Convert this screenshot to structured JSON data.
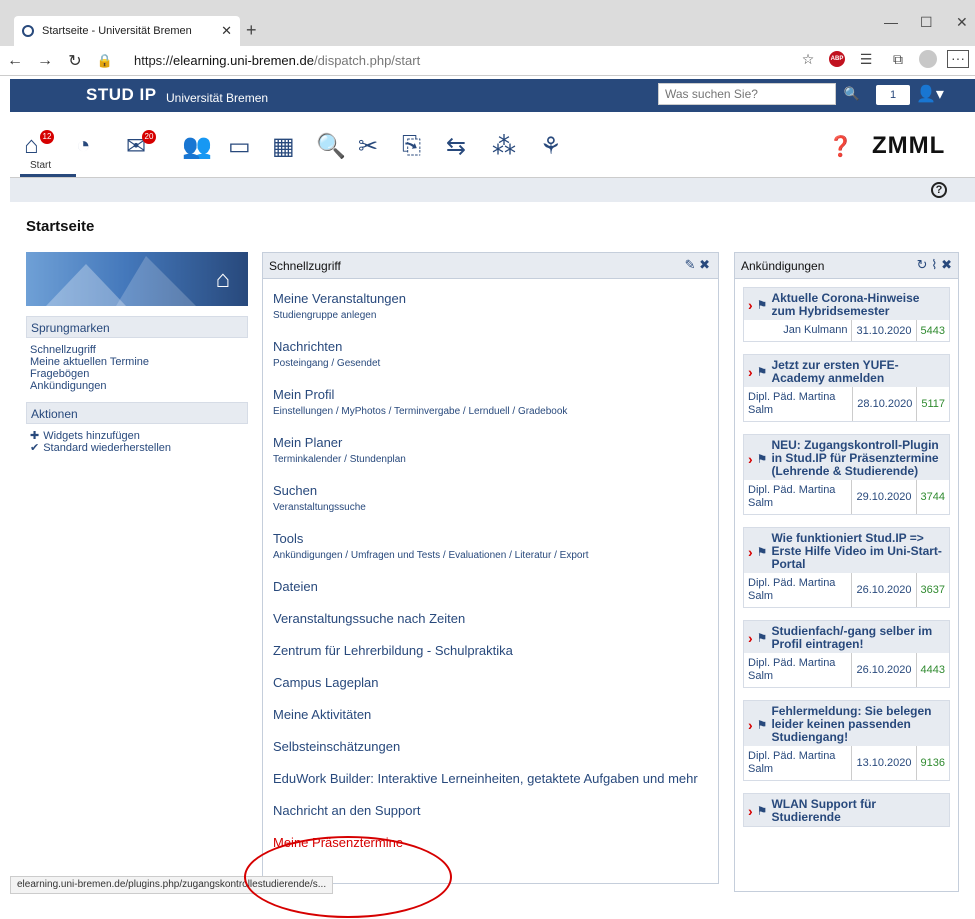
{
  "browser": {
    "tab_title": "Startseite - Universität Bremen",
    "url_scheme": "https://",
    "url_host": "elearning.uni-bremen.de",
    "url_path": "/dispatch.php/start",
    "status_url": "elearning.uni-bremen.de/plugins.php/zugangskontrollestudierende/s..."
  },
  "header": {
    "logo": "STUD IP",
    "university": "Universität Bremen",
    "search_placeholder": "Was suchen Sie?",
    "notification_count": "1"
  },
  "nav": {
    "start_label": "Start",
    "home_badge": "12",
    "messages_badge": "20",
    "brand_right": "ZMML"
  },
  "page": {
    "title": "Startseite"
  },
  "sidebar": {
    "jump_title": "Sprungmarken",
    "jump_links": [
      "Schnellzugriff",
      "Meine aktuellen Termine",
      "Fragebögen",
      "Ankündigungen"
    ],
    "actions_title": "Aktionen",
    "actions": [
      {
        "label": "Widgets hinzufügen",
        "icon": "plus-icon"
      },
      {
        "label": "Standard wiederherstellen",
        "icon": "check-icon"
      }
    ]
  },
  "quickaccess": {
    "title": "Schnellzugriff",
    "items": [
      {
        "title": "Meine Veranstaltungen",
        "sub": "Studiengruppe anlegen"
      },
      {
        "title": "Nachrichten",
        "sub": "Posteingang / Gesendet"
      },
      {
        "title": "Mein Profil",
        "sub": "Einstellungen / MyPhotos / Terminvergabe / Lernduell / Gradebook"
      },
      {
        "title": "Mein Planer",
        "sub": "Terminkalender / Stundenplan"
      },
      {
        "title": "Suchen",
        "sub": "Veranstaltungssuche"
      },
      {
        "title": "Tools",
        "sub": "Ankündigungen / Umfragen und Tests / Evaluationen / Literatur / Export"
      },
      {
        "title": "Dateien",
        "sub": ""
      },
      {
        "title": "Veranstaltungssuche nach Zeiten",
        "sub": ""
      },
      {
        "title": "Zentrum für Lehrerbildung - Schulpraktika",
        "sub": ""
      },
      {
        "title": "Campus Lageplan",
        "sub": ""
      },
      {
        "title": "Meine Aktivitäten",
        "sub": ""
      },
      {
        "title": "Selbsteinschätzungen",
        "sub": ""
      },
      {
        "title": "EduWork Builder: Interaktive Lerneinheiten, getaktete Aufgaben und mehr",
        "sub": ""
      },
      {
        "title": "Nachricht an den Support",
        "sub": ""
      },
      {
        "title": "Meine Präsenztermine",
        "sub": ""
      }
    ]
  },
  "announcements": {
    "title": "Ankündigungen",
    "items": [
      {
        "title": "Aktuelle Corona-Hinweise zum Hybridsemester",
        "author": "Jan Kulmann",
        "date": "31.10.2020",
        "views": "5443"
      },
      {
        "title": "Jetzt zur ersten YUFE-Academy anmelden",
        "author": "Dipl. Päd. Martina Salm",
        "date": "28.10.2020",
        "views": "5117"
      },
      {
        "title": "NEU: Zugangskontroll-Plugin in Stud.IP für Präsenztermine (Lehrende & Studierende)",
        "author": "Dipl. Päd. Martina Salm",
        "date": "29.10.2020",
        "views": "3744"
      },
      {
        "title": "Wie funktioniert Stud.IP => Erste Hilfe Video im Uni-Start-Portal",
        "author": "Dipl. Päd. Martina Salm",
        "date": "26.10.2020",
        "views": "3637"
      },
      {
        "title": "Studienfach/-gang selber im Profil eintragen!",
        "author": "Dipl. Päd. Martina Salm",
        "date": "26.10.2020",
        "views": "4443"
      },
      {
        "title": "Fehlermeldung: Sie belegen leider keinen passenden Studiengang!",
        "author": "Dipl. Päd. Martina Salm",
        "date": "13.10.2020",
        "views": "9136"
      },
      {
        "title": "WLAN Support für Studierende",
        "author": "",
        "date": "",
        "views": ""
      }
    ]
  },
  "colors": {
    "brand": "#28497c",
    "accent_red": "#d60000",
    "panel_bg": "#e7ebf1"
  }
}
